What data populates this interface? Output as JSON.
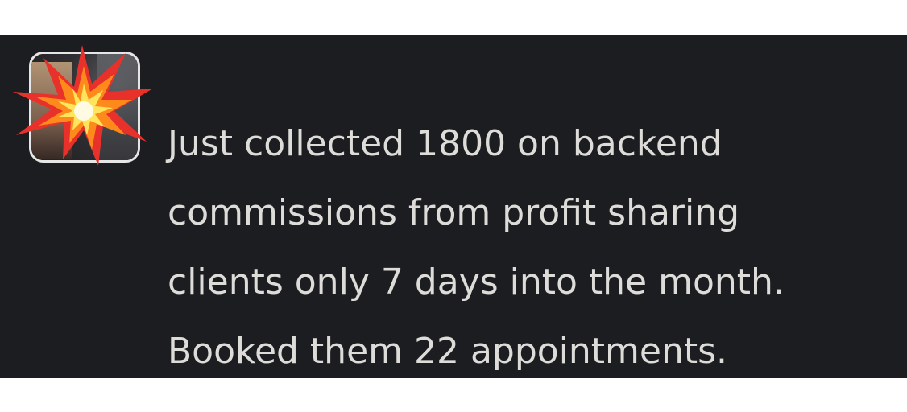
{
  "message": {
    "lines": [
      "Just collected 1800 on backend",
      "commissions from profit sharing",
      "clients only 7 days into the month.",
      "Booked them 22 appointments."
    ]
  },
  "avatar": {
    "overlay_icon": "collision-burst-icon"
  },
  "colors": {
    "panel_background": "#1c1d21",
    "text": "#dddcd8",
    "burst_outer": "#e8312a",
    "burst_inner": "#ffe45c"
  }
}
